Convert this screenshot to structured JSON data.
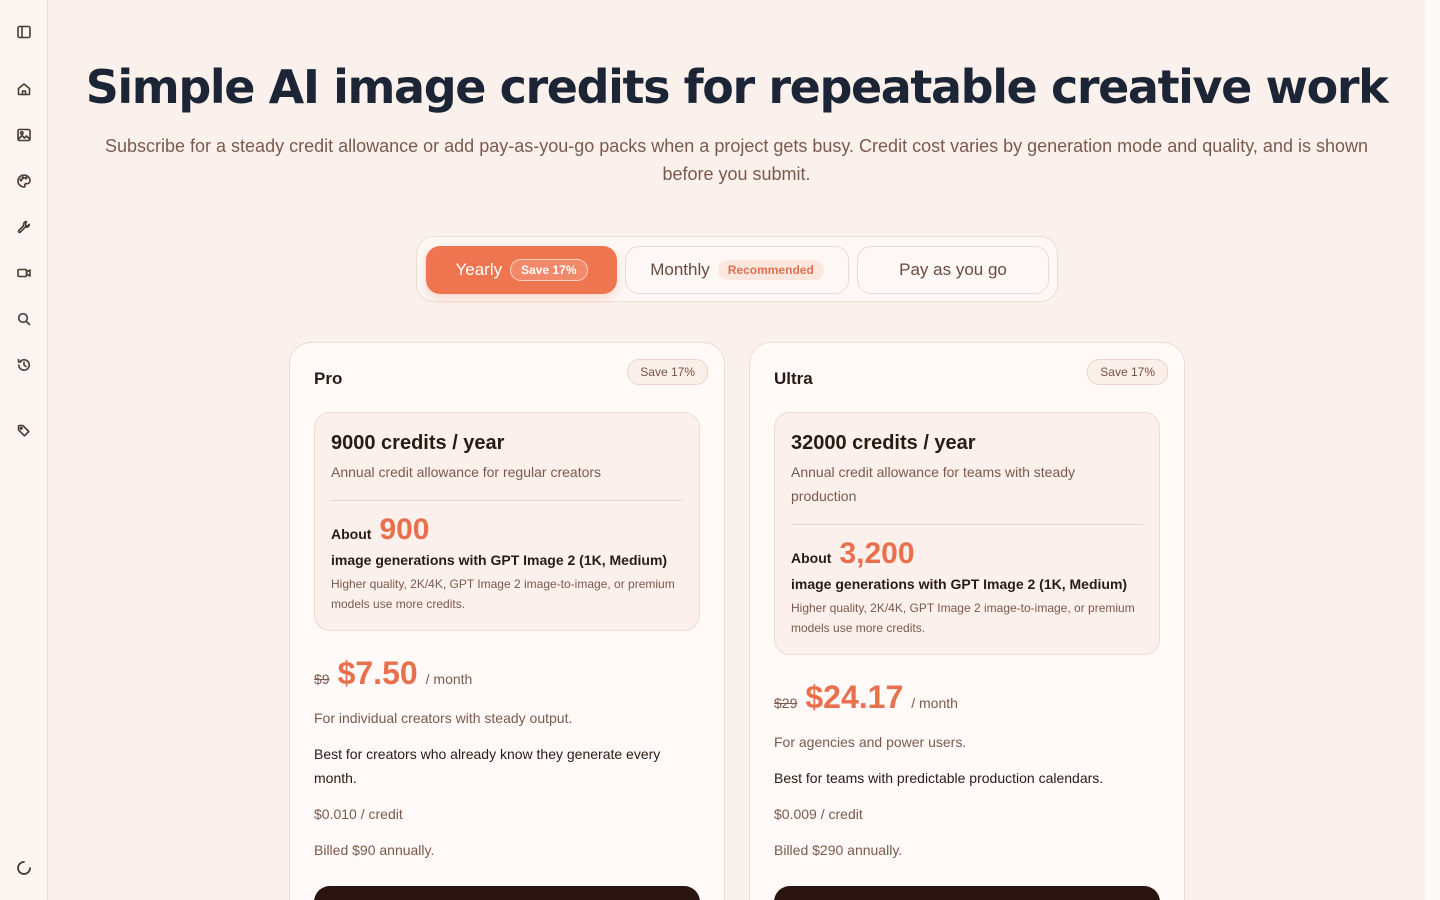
{
  "sidebar": {
    "items": [
      {
        "icon": "sidebar-toggle-icon"
      },
      {
        "icon": "home-icon"
      },
      {
        "icon": "image-icon"
      },
      {
        "icon": "palette-icon"
      },
      {
        "icon": "wrench-icon"
      },
      {
        "icon": "video-icon"
      },
      {
        "icon": "search-icon"
      },
      {
        "icon": "history-icon"
      },
      {
        "icon": "tag-icon"
      },
      {
        "icon": "loading-icon"
      }
    ]
  },
  "hero": {
    "title": "Simple AI image credits for repeatable creative work",
    "subtitle": "Subscribe for a steady credit allowance or add pay-as-you-go packs when a project gets busy. Credit cost varies by generation mode and quality, and is shown before you submit."
  },
  "billing_toggle": {
    "yearly_label": "Yearly",
    "yearly_badge": "Save 17%",
    "monthly_label": "Monthly",
    "monthly_badge": "Recommended",
    "payg_label": "Pay as you go",
    "selected": "Yearly"
  },
  "plans": [
    {
      "name": "Pro",
      "badge": "Save 17%",
      "credits_title": "9000 credits / year",
      "credits_desc": "Annual credit allowance for regular creators",
      "about_label": "About",
      "about_count": "900",
      "generation_line": "image generations with GPT Image 2 (1K, Medium)",
      "generation_note": "Higher quality, 2K/4K, GPT Image 2 image-to-image, or premium models use more credits.",
      "old_price": "$9",
      "price": "$7.50",
      "per": "/ month",
      "tagline": "For individual creators with steady output.",
      "best_for": "Best for creators who already know they generate every month.",
      "per_credit": "$0.010 / credit",
      "billed": "Billed $90 annually."
    },
    {
      "name": "Ultra",
      "badge": "Save 17%",
      "credits_title": "32000 credits / year",
      "credits_desc": "Annual credit allowance for teams with steady production",
      "about_label": "About",
      "about_count": "3,200",
      "generation_line": "image generations with GPT Image 2 (1K, Medium)",
      "generation_note": "Higher quality, 2K/4K, GPT Image 2 image-to-image, or premium models use more credits.",
      "old_price": "$29",
      "price": "$24.17",
      "per": "/ month",
      "tagline": "For agencies and power users.",
      "best_for": "Best for teams with predictable production calendars.",
      "per_credit": "$0.009 / credit",
      "billed": "Billed $290 annually."
    }
  ],
  "colors": {
    "accent": "#ef7550",
    "page_bg": "#fbf1ec",
    "title": "#1c2536",
    "cta_bg": "#2a1410"
  }
}
